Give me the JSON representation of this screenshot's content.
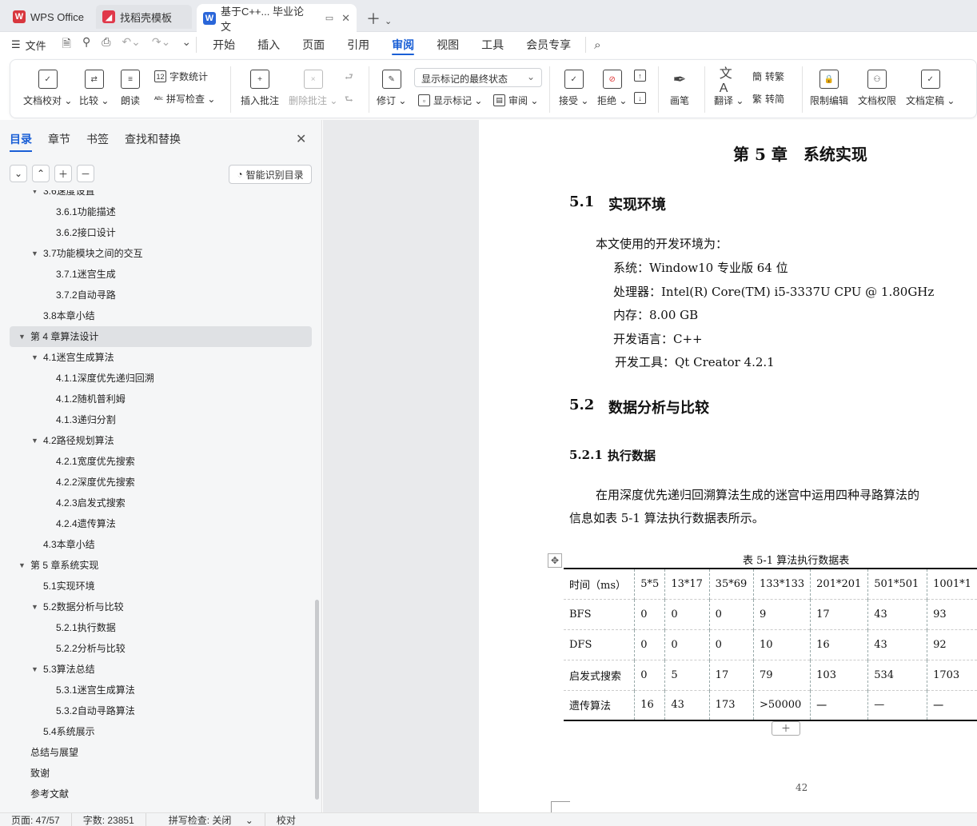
{
  "window": {
    "tabs": [
      {
        "label": "WPS Office",
        "icon": "wps-logo-icon",
        "color": "#d8373e"
      },
      {
        "label": "找稻壳模板",
        "icon": "docer-logo-icon",
        "color": "#e0384a"
      },
      {
        "label": "基于C++... 毕业论文",
        "icon": "writer-doc-icon",
        "color": "#2a66d9"
      }
    ]
  },
  "menubar": {
    "file": "文件",
    "items": [
      "开始",
      "插入",
      "页面",
      "引用",
      "审阅",
      "视图",
      "工具",
      "会员专享"
    ],
    "active": "审阅"
  },
  "ribbon": {
    "doc_check": "文档校对",
    "compare": "比较",
    "read_aloud": "朗读",
    "word_count": "字数统计",
    "spell_check": "拼写检查",
    "insert_comment": "插入批注",
    "delete_comment": "删除批注",
    "track": "修订",
    "display_state": "显示标记的最终状态",
    "show_markup": "显示标记",
    "review": "审阅",
    "accept": "接受",
    "reject": "拒绝",
    "pen": "画笔",
    "translate": "翻译",
    "to_traditional": "转繁",
    "to_simplified": "转简",
    "restrict_edit": "限制编辑",
    "doc_permission": "文档权限",
    "finalize": "文档定稿"
  },
  "nav": {
    "tabs": [
      "目录",
      "章节",
      "书签",
      "查找和替换"
    ],
    "smart_toc": "智能识别目录",
    "items": [
      {
        "label": "3.6速度设置",
        "level": 2,
        "arrow": true
      },
      {
        "label": "3.6.1功能描述",
        "level": 3
      },
      {
        "label": "3.6.2接口设计",
        "level": 3
      },
      {
        "label": "3.7功能模块之间的交互",
        "level": 2,
        "arrow": true
      },
      {
        "label": "3.7.1迷宫生成",
        "level": 3
      },
      {
        "label": "3.7.2自动寻路",
        "level": 3
      },
      {
        "label": "3.8本章小结",
        "level": 2
      },
      {
        "label": "第 4 章算法设计",
        "level": 1,
        "arrow": true,
        "selected": true
      },
      {
        "label": "4.1迷宫生成算法",
        "level": 2,
        "arrow": true
      },
      {
        "label": "4.1.1深度优先递归回溯",
        "level": 3
      },
      {
        "label": "4.1.2随机普利姆",
        "level": 3
      },
      {
        "label": "4.1.3递归分割",
        "level": 3
      },
      {
        "label": "4.2路径规划算法",
        "level": 2,
        "arrow": true
      },
      {
        "label": "4.2.1宽度优先搜索",
        "level": 3
      },
      {
        "label": "4.2.2深度优先搜索",
        "level": 3
      },
      {
        "label": "4.2.3启发式搜索",
        "level": 3
      },
      {
        "label": "4.2.4遗传算法",
        "level": 3
      },
      {
        "label": "4.3本章小结",
        "level": 2
      },
      {
        "label": "第 5 章系统实现",
        "level": 1,
        "arrow": true
      },
      {
        "label": "5.1实现环境",
        "level": 2
      },
      {
        "label": "5.2数据分析与比较",
        "level": 2,
        "arrow": true
      },
      {
        "label": "5.2.1执行数据",
        "level": 3
      },
      {
        "label": "5.2.2分析与比较",
        "level": 3
      },
      {
        "label": "5.3算法总结",
        "level": 2,
        "arrow": true
      },
      {
        "label": "5.3.1迷宫生成算法",
        "level": 3
      },
      {
        "label": "5.3.2自动寻路算法",
        "level": 3
      },
      {
        "label": "5.4系统展示",
        "level": 2
      },
      {
        "label": "总结与展望",
        "level": 1
      },
      {
        "label": "致谢",
        "level": 1
      },
      {
        "label": "参考文献",
        "level": 1
      }
    ]
  },
  "doc": {
    "chapter": "第 5 章　系统实现",
    "s51_num": "5.1",
    "s51_title": "实现环境",
    "intro": "本文使用的开发环境为：",
    "env": [
      "系统：Window10 专业版  64 位",
      "处理器：Intel(R) Core(TM) i5-3337U CPU @ 1.80GHz",
      "内存：8.00 GB",
      "开发语言：C++",
      "开发工具：Qt Creator 4.2.1"
    ],
    "s52_num": "5.2",
    "s52_title": "数据分析与比较",
    "s521_num": "5.2.1",
    "s521_title": "执行数据",
    "para1": "在用深度优先递归回溯算法生成的迷宫中运用四种寻路算法的",
    "para2": "信息如表 5-1 算法执行数据表所示。",
    "table_caption": "表 5-1 算法执行数据表",
    "table": {
      "header": [
        "时间（ms）",
        "5*5",
        "13*17",
        "35*69",
        "133*133",
        "201*201",
        "501*501",
        "1001*1"
      ],
      "rows": [
        [
          "BFS",
          "0",
          "0",
          "0",
          "9",
          "17",
          "43",
          "93"
        ],
        [
          "DFS",
          "0",
          "0",
          "0",
          "10",
          "16",
          "43",
          "92"
        ],
        [
          "启发式搜索",
          "0",
          "5",
          "17",
          "79",
          "103",
          "534",
          "1703"
        ],
        [
          "遗传算法",
          "16",
          "43",
          "173",
          ">50000",
          "一",
          "—",
          "一"
        ]
      ]
    },
    "page_number": "42"
  },
  "status": {
    "page": "页面: 47/57",
    "words": "字数: 23851",
    "spell": "拼写检查: 关闭",
    "proof": "校对"
  }
}
